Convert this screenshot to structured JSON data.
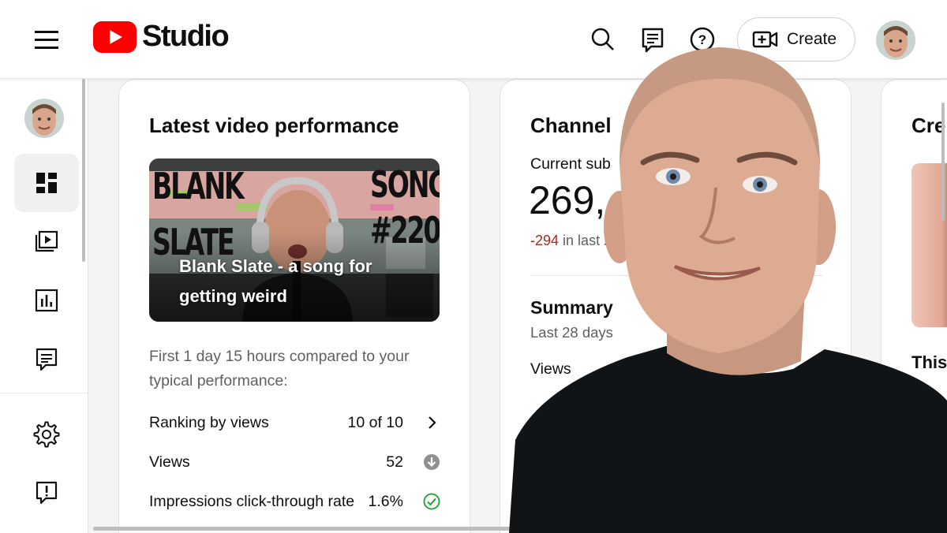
{
  "header": {
    "menu_icon": "hamburger-menu-icon",
    "logo_text": "Studio",
    "brand_color": "#ff0000",
    "search_icon": "search-icon",
    "comments_icon": "comments-icon",
    "help_icon": "help-icon",
    "create_label": "Create",
    "create_icon": "create-video-icon"
  },
  "sidebar": {
    "items": [
      {
        "name": "dashboard",
        "icon": "dashboard-icon",
        "active": true
      },
      {
        "name": "content",
        "icon": "content-icon",
        "active": false
      },
      {
        "name": "analytics",
        "icon": "analytics-icon",
        "active": false
      },
      {
        "name": "comments",
        "icon": "comments-icon",
        "active": false
      },
      {
        "name": "settings",
        "icon": "gear-icon",
        "active": false
      },
      {
        "name": "feedback",
        "icon": "feedback-icon",
        "active": false
      }
    ]
  },
  "latest_video": {
    "title": "Latest video performance",
    "thumbnail": {
      "text_left_top": "BLANK",
      "text_left_bottom": "SLATE",
      "text_right_top": "SONG",
      "text_right_bottom": "#220",
      "caption": "Blank Slate - a song for getting weird"
    },
    "compare_text": "First 1 day 15 hours compared to your typical performance:",
    "metrics": [
      {
        "label": "Ranking by views",
        "value": "10 of 10",
        "icon": "chevron-right-icon"
      },
      {
        "label": "Views",
        "value": "52",
        "icon": "arrow-down-circle-icon",
        "icon_color": "#909090"
      },
      {
        "label": "Impressions click-through rate",
        "value": "1.6%",
        "icon": "check-circle-icon",
        "icon_color": "#2ba640"
      }
    ]
  },
  "channel": {
    "title": "Channel",
    "subscribers_label": "Current sub",
    "subscribers_value": "269,",
    "change_value": "-294",
    "change_suffix": "in last 28",
    "change_color": "#b3261e",
    "summary_title": "Summary",
    "summary_period": "Last 28 days",
    "views_label": "Views"
  },
  "creator": {
    "title": "Cre",
    "text": "This"
  }
}
